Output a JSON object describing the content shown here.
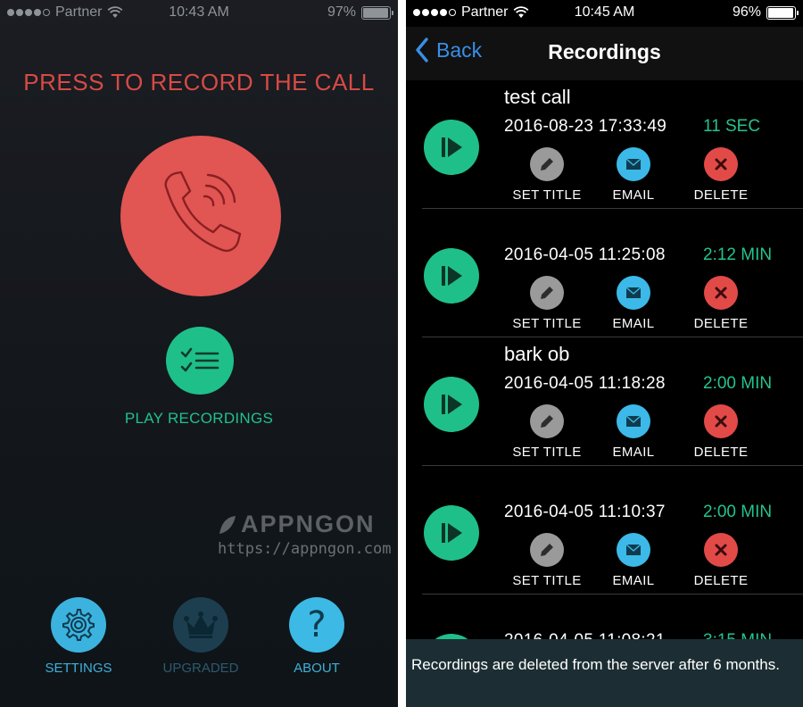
{
  "left": {
    "status": {
      "carrier": "Partner",
      "time": "10:43 AM",
      "battery": "97%",
      "battery_level": 0.97
    },
    "title": "PRESS TO RECORD THE CALL",
    "play_recordings_label": "PLAY RECORDINGS",
    "watermark": {
      "brand": "APPNGON",
      "url": "https://appngon.com"
    },
    "bottom": {
      "settings_label": "SETTINGS",
      "upgraded_label": "UPGRADED",
      "about_label": "ABOUT",
      "about_glyph": "?"
    },
    "colors": {
      "accent_red": "#e15553",
      "accent_green": "#1fbf8a",
      "accent_blue": "#3cb3df"
    }
  },
  "right": {
    "status": {
      "carrier": "Partner",
      "time": "10:45 AM",
      "battery": "96%",
      "battery_level": 0.96
    },
    "nav": {
      "back_label": "Back",
      "title": "Recordings"
    },
    "actions": {
      "set_title": "SET TITLE",
      "email": "EMAIL",
      "delete": "DELETE"
    },
    "recordings": [
      {
        "title": "test call",
        "date": "2016-08-23 17:33:49",
        "duration": "11 SEC"
      },
      {
        "title": "",
        "date": "2016-04-05 11:25:08",
        "duration": "2:12 MIN"
      },
      {
        "title": "bark ob",
        "date": "2016-04-05 11:18:28",
        "duration": "2:00 MIN"
      },
      {
        "title": "",
        "date": "2016-04-05 11:10:37",
        "duration": "2:00 MIN"
      },
      {
        "title": "",
        "date": "2016-04-05 11:08:21",
        "duration": "3:15 MIN"
      }
    ],
    "footer_note": "Recordings are deleted from the server after 6 months.",
    "colors": {
      "play_green": "#1fbf8a",
      "duration_green": "#24c38e",
      "email_blue": "#3cb9e8",
      "delete_red": "#e24a48",
      "settitle_gray": "#9a9a9a"
    }
  }
}
